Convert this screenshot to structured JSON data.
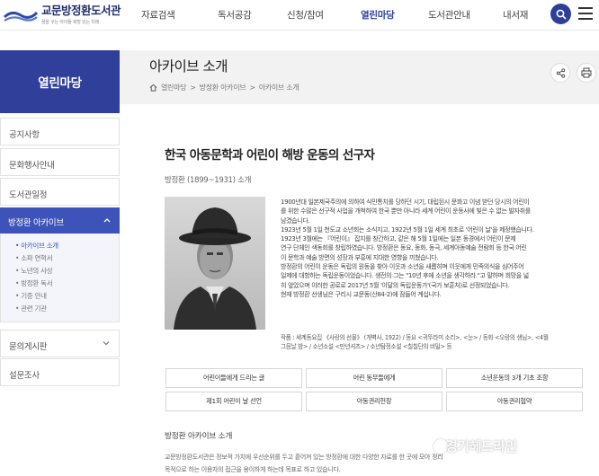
{
  "header": {
    "logo_text": "교문방정환도서관",
    "logo_sub": "꿈을 꾸는 아이들 희망 있는 미래",
    "nav": [
      "자료검색",
      "독서공감",
      "신청/참여",
      "열린마당",
      "도서관안내",
      "내서재"
    ],
    "nav_active_index": 3
  },
  "sidebar": {
    "title": "열린마당",
    "items": [
      "공지사항",
      "문화행사안내",
      "도서관일정"
    ],
    "active": "방정환 아카이브",
    "sub_items": [
      "• 아카이브 소개",
      "• 소파 연혁서",
      "• 노년의 사상",
      "• 방정환 독서",
      "• 기증 안내",
      "• 관련 기관"
    ],
    "sub_active_index": 0,
    "bottom_items": [
      "묻의게시판",
      "설문조사"
    ]
  },
  "page": {
    "title": "아카이브 소개",
    "breadcrumb": [
      "열린마당",
      "방정환 아카이브",
      "아카이브 소개"
    ]
  },
  "article": {
    "title": "한국 아동문학과 어린이 해방 운동의 선구자",
    "subtitle": "방정환 (1899~1931) 소개",
    "paragraphs": [
      "1900년대 일본제국주의에 의하여 식민통치를 당하던 시기, 대립된시 문화고 이념 받던 당시의 어린이",
      "를 위한 수많은 선구적 사업을 개척하여 한국 뿐만 아니라 세계 어린이 운동사에 빛은 수 없는 발자취를",
      "남겼습니다.",
      "1923년 5월 1일 천도교 소년회는 소식지고, 1922년 5월 1일 세계 최초로 '어린이 날'을 제정했습니다.",
      "1923년 3월에는 『어린이』 잡지를 창간하고, 같은 해 5월 1일에는 일본 동경에서 어린이 문제",
      "연구 단체인 색동회를 창립하였습니다. 방정환은 동요, 동화, 동극, 세계아동예술 전람회 등 한국 어린",
      "이 문학과 예술 방면의 성장과 부흥에 지대한 영향을 끼쳤습니다.",
      "방정환의 어린이 운동은 독립의 원동을 찾아 이웃과 소년을 새롭히며 이웃에게 민족의식을 심어주어",
      "일제에 대항하는 독립운동이었습니다. 생전의 그는 \"10년 후에 소년을 생각하라.\"고 말하며 희망을 넓",
      "히 앞았으며 이러한 공로로 2017년 5월 '이달의 독립운동가'(국가 보훈처)로 선정되었습니다.",
      "현재 방정환 선생님은 구리시 교문동(산84-2)에 잠들어 계십니다."
    ],
    "works": [
      "작품 : 세계동요집 《사랑의 선물》 (개벽사, 1922) / 동요 <귀뚜라미 소리>, <눈> / 동화 <오랑의 생님>, <4월",
      "그믐날 밤> / 소년소설 <만년셔츠> / 소년탐정소설 <칠칠단의 비밀> 등"
    ],
    "buttons": [
      "어린이들에게 드리는 글",
      "어린 동무들에게",
      "소년운동의 3개 기초 조항",
      "제1회 어린이 날 선언",
      "아동권리헌장",
      "아동권리협약"
    ]
  },
  "archive_intro": {
    "title": "방정환 아카이브 소개",
    "lines": [
      "교문방정환도서관은 정보적 가치에 우선순위를 두고 흩어져 있는 방정환에 대한 다양한 자료를 한 곳에 모아 정리",
      "목적으로 하는 이용자의 접근을 용이하게 하는데 목표로 하고 있습니다."
    ]
  },
  "watermark": "경기헤드라인"
}
